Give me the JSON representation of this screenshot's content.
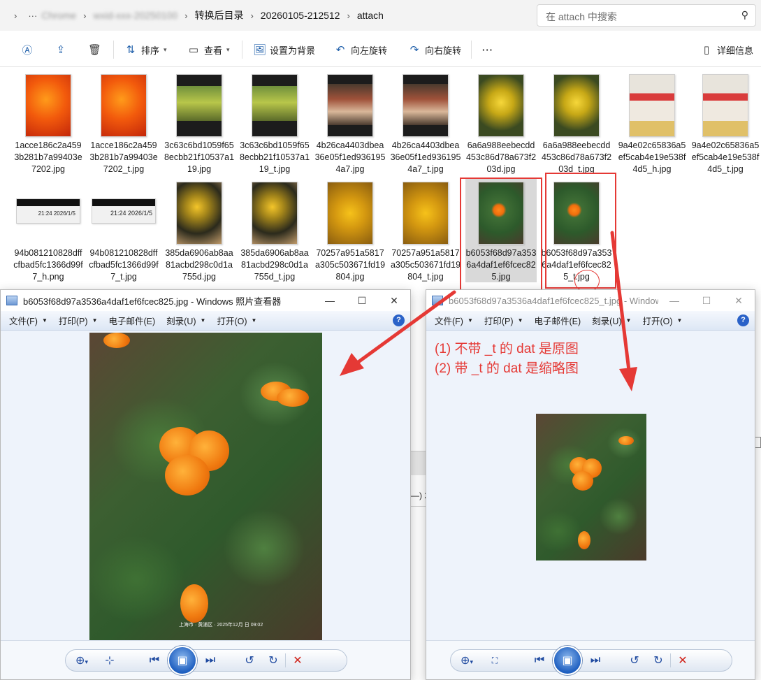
{
  "explorer": {
    "breadcrumb": [
      "Chrome",
      "wxid-xxx-20250100",
      "转换后目录",
      "20260105-212512",
      "attach"
    ],
    "search_placeholder": "在 attach 中搜索",
    "commands": {
      "sort": "排序",
      "view": "查看",
      "set_background": "设置为背景",
      "rotate_left": "向左旋转",
      "rotate_right": "向右旋转",
      "more": "···",
      "details": "详细信息"
    },
    "files": [
      {
        "name": "1acce186c2a4593b281b7a99403e7202.jpg",
        "thumb": "orange"
      },
      {
        "name": "1acce186c2a4593b281b7a99403e7202_t.jpg",
        "thumb": "orange"
      },
      {
        "name": "3c63c6bd1059f658ecbb21f10537a119.jpg",
        "thumb": "food"
      },
      {
        "name": "3c63c6bd1059f658ecbb21f10537a119_t.jpg",
        "thumb": "food"
      },
      {
        "name": "4b26ca4403dbea36e05f1ed9361954a7.jpg",
        "thumb": "fish"
      },
      {
        "name": "4b26ca4403dbea36e05f1ed9361954a7_t.jpg",
        "thumb": "fish"
      },
      {
        "name": "6a6a988eebecdd453c86d78a673f203d.jpg",
        "thumb": "yellow"
      },
      {
        "name": "6a6a988eebecdd453c86d78a673f203d_t.jpg",
        "thumb": "yellow"
      },
      {
        "name": "9a4e02c65836a5ef5cab4e19e538f4d5_h.jpg",
        "thumb": "cartoon"
      },
      {
        "name": "9a4e02c65836a5ef5cab4e19e538f4d5_t.jpg",
        "thumb": "cartoon"
      },
      {
        "name": "94b081210828dffcfbad5fc1366d99f7_h.png",
        "thumb": "screen",
        "thumb_text": "21:24 2026/1/5"
      },
      {
        "name": "94b081210828dffcfbad5fc1366d99f7_t.jpg",
        "thumb": "screen",
        "thumb_text": "21:24 2026/1/5"
      },
      {
        "name": "385da6906ab8aa81acbd298c0d1a755d.jpg",
        "thumb": "orchid"
      },
      {
        "name": "385da6906ab8aa81acbd298c0d1a755d_t.jpg",
        "thumb": "orchid"
      },
      {
        "name": "70257a951a5817a305c503671fd19804.jpg",
        "thumb": "gold"
      },
      {
        "name": "70257a951a5817a305c503671fd19804_t.jpg",
        "thumb": "gold"
      },
      {
        "name": "b6053f68d97a3536a4daf1ef6fcec825.jpg",
        "thumb": "pansy",
        "selected": true
      },
      {
        "name": "b6053f68d97a3536a4daf1ef6fcec825_t.jpg",
        "thumb": "pansy"
      }
    ]
  },
  "viewer_left": {
    "title": "b6053f68d97a3536a4daf1ef6fcec825.jpg - Windows 照片查看器",
    "menu": [
      "文件(F)",
      "打印(P)",
      "电子邮件(E)",
      "刻录(U)",
      "打开(O)"
    ],
    "photo_caption": "上海市 · 黄浦区 · 2025年12月 日 09:02"
  },
  "viewer_right": {
    "title": "b6053f68d97a3536a4daf1ef6fcec825_t.jpg - Windows...",
    "menu": [
      "文件(F)",
      "打印(P)",
      "电子邮件(E)",
      "刻录(U)",
      "打开(O)"
    ]
  },
  "annotation": {
    "line1": "(1) 不带 _t 的 dat 是原图",
    "line2": "(2) 带 _t 的 dat 是缩略图",
    "color": "#e53935"
  },
  "bg_window_fragment": "—) 2"
}
